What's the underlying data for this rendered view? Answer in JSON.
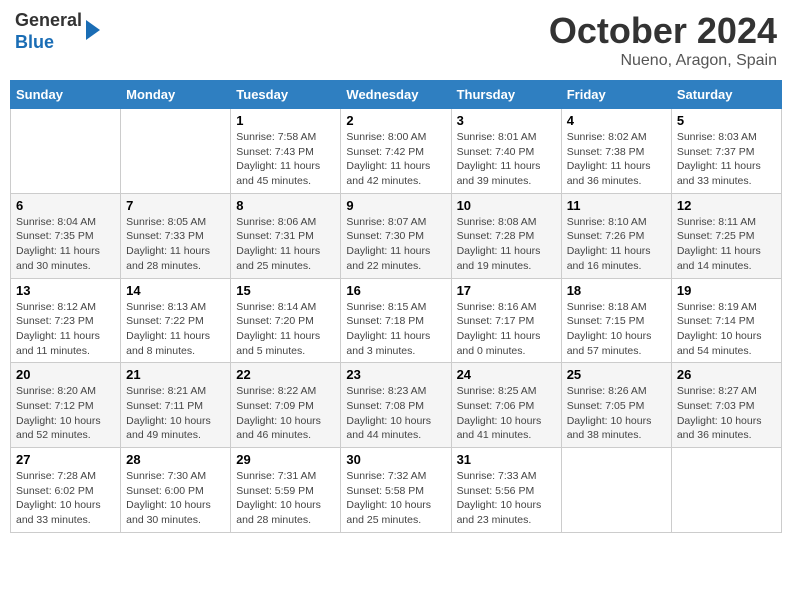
{
  "header": {
    "logo_line1": "General",
    "logo_line2": "Blue",
    "title": "October 2024",
    "subtitle": "Nueno, Aragon, Spain"
  },
  "weekdays": [
    "Sunday",
    "Monday",
    "Tuesday",
    "Wednesday",
    "Thursday",
    "Friday",
    "Saturday"
  ],
  "weeks": [
    [
      {
        "day": "",
        "info": ""
      },
      {
        "day": "",
        "info": ""
      },
      {
        "day": "1",
        "info": "Sunrise: 7:58 AM\nSunset: 7:43 PM\nDaylight: 11 hours and 45 minutes."
      },
      {
        "day": "2",
        "info": "Sunrise: 8:00 AM\nSunset: 7:42 PM\nDaylight: 11 hours and 42 minutes."
      },
      {
        "day": "3",
        "info": "Sunrise: 8:01 AM\nSunset: 7:40 PM\nDaylight: 11 hours and 39 minutes."
      },
      {
        "day": "4",
        "info": "Sunrise: 8:02 AM\nSunset: 7:38 PM\nDaylight: 11 hours and 36 minutes."
      },
      {
        "day": "5",
        "info": "Sunrise: 8:03 AM\nSunset: 7:37 PM\nDaylight: 11 hours and 33 minutes."
      }
    ],
    [
      {
        "day": "6",
        "info": "Sunrise: 8:04 AM\nSunset: 7:35 PM\nDaylight: 11 hours and 30 minutes."
      },
      {
        "day": "7",
        "info": "Sunrise: 8:05 AM\nSunset: 7:33 PM\nDaylight: 11 hours and 28 minutes."
      },
      {
        "day": "8",
        "info": "Sunrise: 8:06 AM\nSunset: 7:31 PM\nDaylight: 11 hours and 25 minutes."
      },
      {
        "day": "9",
        "info": "Sunrise: 8:07 AM\nSunset: 7:30 PM\nDaylight: 11 hours and 22 minutes."
      },
      {
        "day": "10",
        "info": "Sunrise: 8:08 AM\nSunset: 7:28 PM\nDaylight: 11 hours and 19 minutes."
      },
      {
        "day": "11",
        "info": "Sunrise: 8:10 AM\nSunset: 7:26 PM\nDaylight: 11 hours and 16 minutes."
      },
      {
        "day": "12",
        "info": "Sunrise: 8:11 AM\nSunset: 7:25 PM\nDaylight: 11 hours and 14 minutes."
      }
    ],
    [
      {
        "day": "13",
        "info": "Sunrise: 8:12 AM\nSunset: 7:23 PM\nDaylight: 11 hours and 11 minutes."
      },
      {
        "day": "14",
        "info": "Sunrise: 8:13 AM\nSunset: 7:22 PM\nDaylight: 11 hours and 8 minutes."
      },
      {
        "day": "15",
        "info": "Sunrise: 8:14 AM\nSunset: 7:20 PM\nDaylight: 11 hours and 5 minutes."
      },
      {
        "day": "16",
        "info": "Sunrise: 8:15 AM\nSunset: 7:18 PM\nDaylight: 11 hours and 3 minutes."
      },
      {
        "day": "17",
        "info": "Sunrise: 8:16 AM\nSunset: 7:17 PM\nDaylight: 11 hours and 0 minutes."
      },
      {
        "day": "18",
        "info": "Sunrise: 8:18 AM\nSunset: 7:15 PM\nDaylight: 10 hours and 57 minutes."
      },
      {
        "day": "19",
        "info": "Sunrise: 8:19 AM\nSunset: 7:14 PM\nDaylight: 10 hours and 54 minutes."
      }
    ],
    [
      {
        "day": "20",
        "info": "Sunrise: 8:20 AM\nSunset: 7:12 PM\nDaylight: 10 hours and 52 minutes."
      },
      {
        "day": "21",
        "info": "Sunrise: 8:21 AM\nSunset: 7:11 PM\nDaylight: 10 hours and 49 minutes."
      },
      {
        "day": "22",
        "info": "Sunrise: 8:22 AM\nSunset: 7:09 PM\nDaylight: 10 hours and 46 minutes."
      },
      {
        "day": "23",
        "info": "Sunrise: 8:23 AM\nSunset: 7:08 PM\nDaylight: 10 hours and 44 minutes."
      },
      {
        "day": "24",
        "info": "Sunrise: 8:25 AM\nSunset: 7:06 PM\nDaylight: 10 hours and 41 minutes."
      },
      {
        "day": "25",
        "info": "Sunrise: 8:26 AM\nSunset: 7:05 PM\nDaylight: 10 hours and 38 minutes."
      },
      {
        "day": "26",
        "info": "Sunrise: 8:27 AM\nSunset: 7:03 PM\nDaylight: 10 hours and 36 minutes."
      }
    ],
    [
      {
        "day": "27",
        "info": "Sunrise: 7:28 AM\nSunset: 6:02 PM\nDaylight: 10 hours and 33 minutes."
      },
      {
        "day": "28",
        "info": "Sunrise: 7:30 AM\nSunset: 6:00 PM\nDaylight: 10 hours and 30 minutes."
      },
      {
        "day": "29",
        "info": "Sunrise: 7:31 AM\nSunset: 5:59 PM\nDaylight: 10 hours and 28 minutes."
      },
      {
        "day": "30",
        "info": "Sunrise: 7:32 AM\nSunset: 5:58 PM\nDaylight: 10 hours and 25 minutes."
      },
      {
        "day": "31",
        "info": "Sunrise: 7:33 AM\nSunset: 5:56 PM\nDaylight: 10 hours and 23 minutes."
      },
      {
        "day": "",
        "info": ""
      },
      {
        "day": "",
        "info": ""
      }
    ]
  ]
}
